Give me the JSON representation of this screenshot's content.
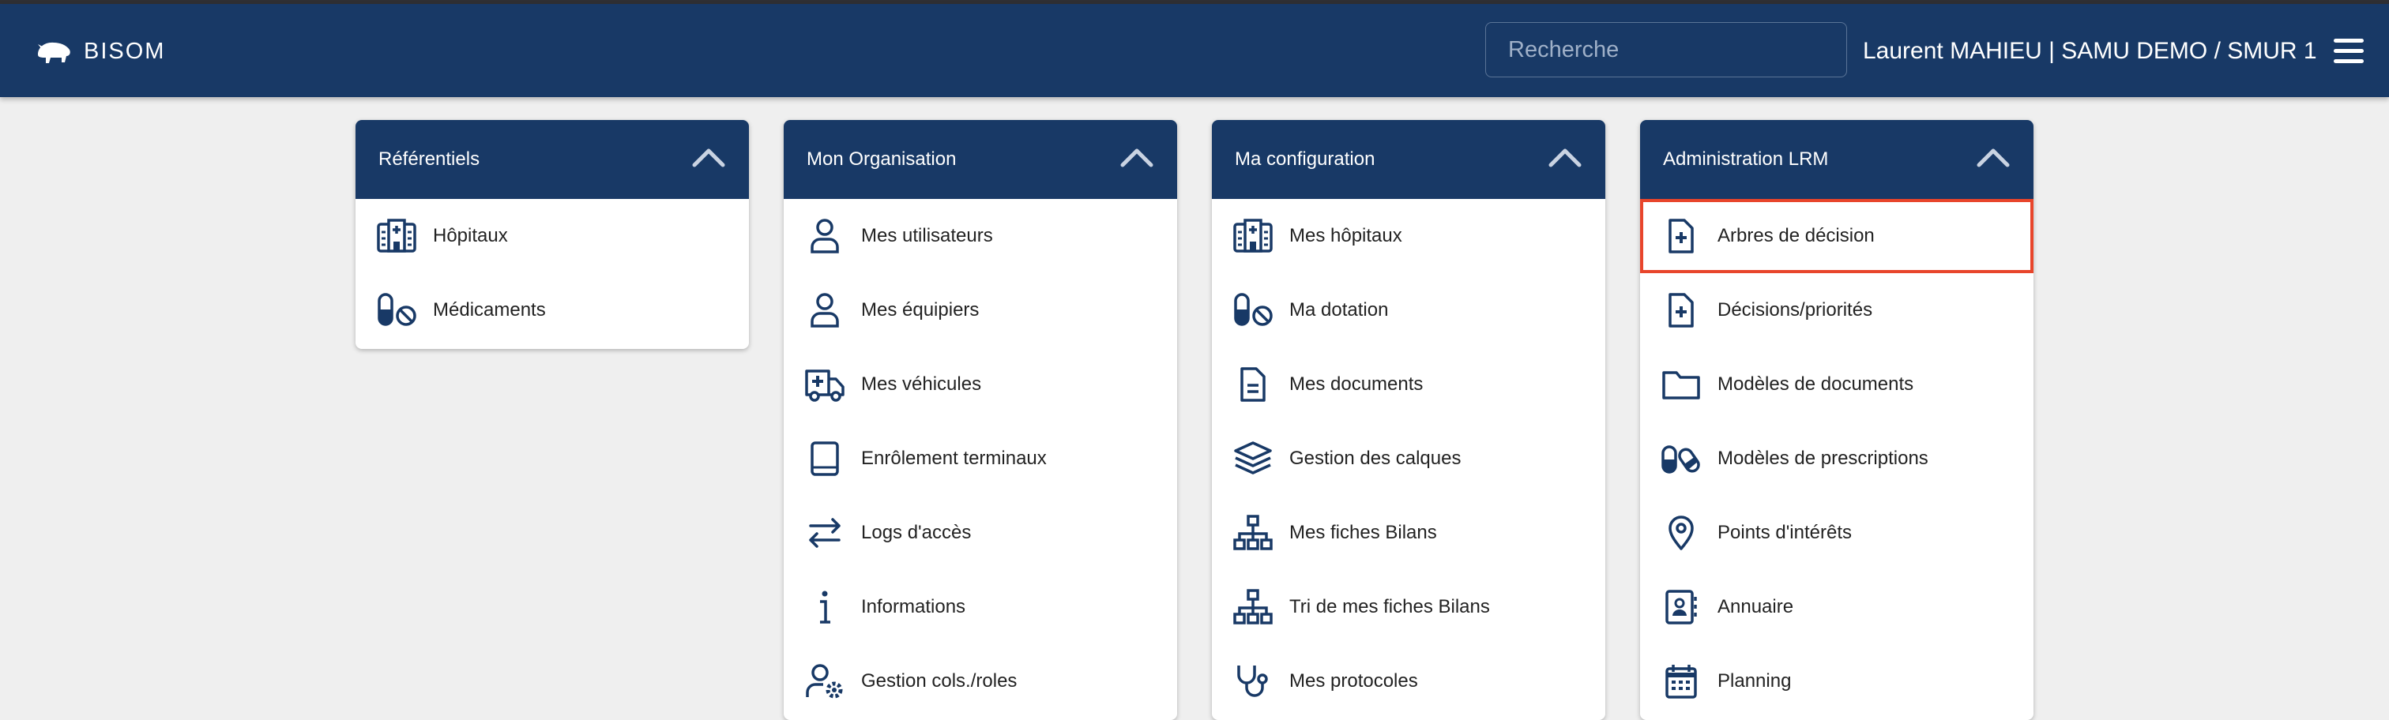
{
  "header": {
    "brand": "BISOM",
    "search_placeholder": "Recherche",
    "user": "Laurent MAHIEU  |  SAMU DEMO / SMUR 1"
  },
  "colors": {
    "navy": "#183966",
    "highlight": "#e8452b"
  },
  "cards": [
    {
      "title": "Référentiels",
      "items": [
        {
          "icon": "hospital-icon",
          "label": "Hôpitaux"
        },
        {
          "icon": "pill-ban-icon",
          "label": "Médicaments"
        }
      ]
    },
    {
      "title": "Mon Organisation",
      "items": [
        {
          "icon": "user-icon",
          "label": "Mes utilisateurs"
        },
        {
          "icon": "user-icon",
          "label": "Mes équipiers"
        },
        {
          "icon": "ambulance-icon",
          "label": "Mes véhicules"
        },
        {
          "icon": "tablet-icon",
          "label": "Enrôlement terminaux"
        },
        {
          "icon": "arrows-exchange-icon",
          "label": "Logs d'accès"
        },
        {
          "icon": "info-icon",
          "label": "Informations"
        },
        {
          "icon": "user-gear-icon",
          "label": "Gestion cols./roles"
        }
      ]
    },
    {
      "title": "Ma configuration",
      "items": [
        {
          "icon": "hospital-icon",
          "label": "Mes hôpitaux"
        },
        {
          "icon": "pill-ban-icon",
          "label": "Ma dotation"
        },
        {
          "icon": "document-icon",
          "label": "Mes documents"
        },
        {
          "icon": "layers-icon",
          "label": "Gestion des calques"
        },
        {
          "icon": "sitemap-icon",
          "label": "Mes fiches Bilans"
        },
        {
          "icon": "sitemap-icon",
          "label": "Tri de mes fiches Bilans"
        },
        {
          "icon": "stethoscope-icon",
          "label": "Mes protocoles"
        }
      ]
    },
    {
      "title": "Administration LRM",
      "items": [
        {
          "icon": "file-medical-icon",
          "label": "Arbres de décision",
          "selected": true
        },
        {
          "icon": "file-medical-icon",
          "label": "Décisions/priorités"
        },
        {
          "icon": "folder-icon",
          "label": "Modèles de documents"
        },
        {
          "icon": "pills-icon",
          "label": "Modèles de prescriptions"
        },
        {
          "icon": "map-pin-icon",
          "label": "Points d'intérêts"
        },
        {
          "icon": "contact-book-icon",
          "label": "Annuaire"
        },
        {
          "icon": "calendar-icon",
          "label": "Planning"
        }
      ]
    }
  ]
}
